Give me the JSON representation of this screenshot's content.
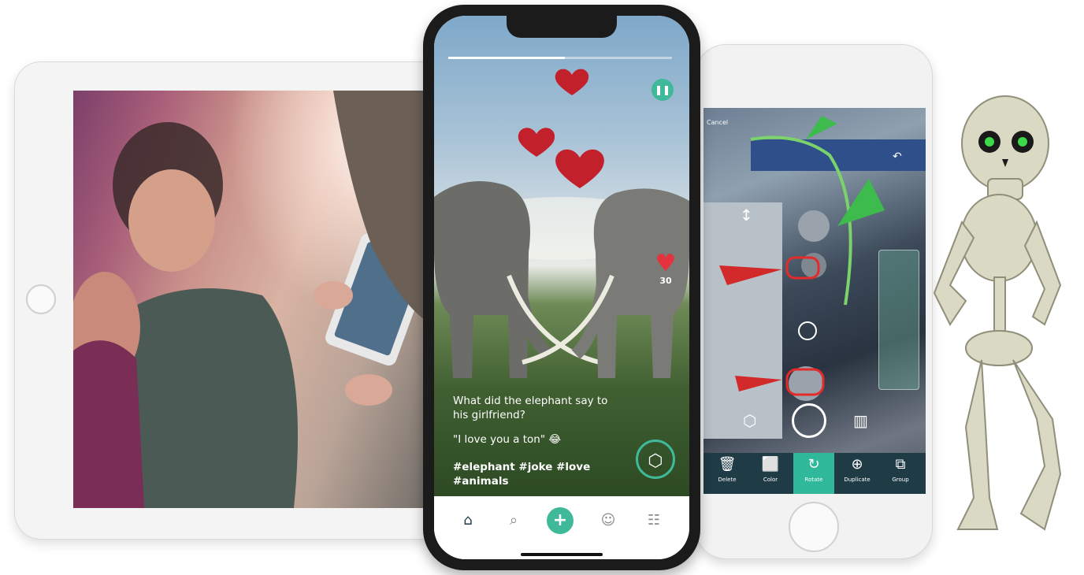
{
  "center_phone": {
    "progress_fraction": 0.52,
    "pause_icon": "pause-icon",
    "like_count": "30",
    "caption_question": "What did the elephant say to his girlfriend?",
    "caption_answer": "\"I love you a ton\" 😂",
    "hashtags": "#elephant #joke #love #animals",
    "nav": [
      {
        "icon": "home-icon"
      },
      {
        "icon": "search-icon"
      },
      {
        "icon": "add-icon"
      },
      {
        "icon": "profile-icon"
      },
      {
        "icon": "community-icon"
      }
    ],
    "colors": {
      "accent": "#3fb99a",
      "heart": "#e2333f"
    }
  },
  "right_phone": {
    "toolbar": [
      {
        "label": "Delete",
        "icon": "trash-icon"
      },
      {
        "label": "Color",
        "icon": "color-swatch-icon"
      },
      {
        "label": "Rotate",
        "icon": "rotate-icon"
      },
      {
        "label": "Duplicate",
        "icon": "duplicate-icon"
      },
      {
        "label": "Group",
        "icon": "group-icon"
      }
    ],
    "top_label": "Cancel",
    "colors": {
      "toolbar": "#1f3b46",
      "active": "#2fb89a"
    }
  }
}
